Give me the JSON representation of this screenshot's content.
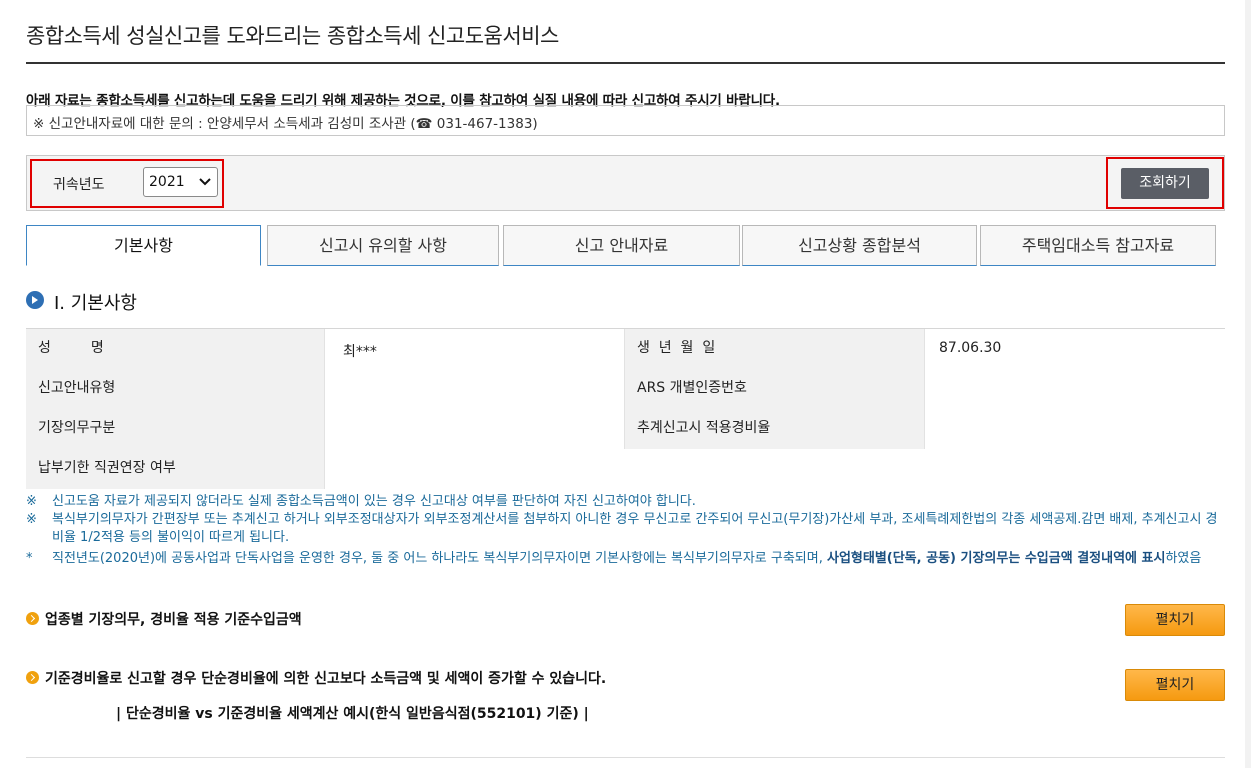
{
  "header": {
    "title": "종합소득세 성실신고를 도와드리는 종합소득세 신고도움서비스"
  },
  "notice": {
    "main": "아래 자료는 종합소득세를 신고하는데 도움을 드리기 위해 제공하는 것으로, 이를 참고하여 실질 내용에 따라 신고하여 주시기 바랍니다.",
    "contact": "※ 신고안내자료에 대한 문의 : 안양세무서 소득세과 김성미 조사관 (☎ 031-467-1383)"
  },
  "filter": {
    "year_label": "귀속년도",
    "year_value": "2021",
    "search_label": "조회하기"
  },
  "tabs": [
    {
      "label": "기본사항",
      "active": true
    },
    {
      "label": "신고시 유의할 사항",
      "active": false
    },
    {
      "label": "신고 안내자료",
      "active": false
    },
    {
      "label": "신고상황 종합분석",
      "active": false
    },
    {
      "label": "주택임대소득 참고자료",
      "active": false
    }
  ],
  "section": {
    "title": "Ⅰ. 기본사항"
  },
  "basic_info": {
    "name_label": "성         명",
    "name_value": "최***",
    "birth_label": "생  년  월  일",
    "birth_value": "87.06.30",
    "guide_type_label": "신고안내유형",
    "guide_type_value": "",
    "ars_label": "ARS 개별인증번호",
    "ars_value": "",
    "bookkeeping_label": "기장의무구분",
    "bookkeeping_value": "",
    "estimated_rate_label": "추계신고시 적용경비율",
    "estimated_rate_value": "",
    "deadline_label": "납부기한 직권연장 여부",
    "deadline_value": ""
  },
  "notes": [
    {
      "mark": "※",
      "text": "신고도움 자료가 제공되지 않더라도 실제 종합소득금액이 있는 경우 신고대상 여부를 판단하여 자진 신고하여야 합니다."
    },
    {
      "mark": "※",
      "text": "복식부기의무자가 간편장부 또는 추계신고 하거나 외부조정대상자가 외부조정계산서를 첨부하지 아니한 경우 무신고로 간주되어 무신고(무기장)가산세 부과, 조세특례제한법의 각종 세액공제.감면 배제, 추계신고시 경비율 1/2적용 등의 불이익이 따르게 됩니다."
    },
    {
      "mark": "*",
      "text": "직전년도(2020년)에 공동사업과 단독사업을 운영한 경우, 둘 중 어느 하나라도 복식부기의무자이면 기본사항에는 복식부기의무자로 구축되며, ",
      "strong": "사업형태별(단독, 공동) 기장의무는 수입금액 결정내역에 표시",
      "tail": "하였음"
    }
  ],
  "sub_sections": [
    {
      "title": "업종별 기장의무, 경비율 적용 기준수입금액",
      "button": "펼치기"
    },
    {
      "title": "기준경비율로 신고할 경우 단순경비율에 의한 신고보다 소득금액 및 세액이 증가할 수 있습니다.",
      "button": "펼치기"
    }
  ],
  "example_caption": "| 단순경비율 vs 기준경비율 세액계산 예시(한식 일반음식점(552101) 기준) |",
  "colors": {
    "accent_blue": "#3e86c4",
    "highlight_red": "#e00000",
    "orange_button": "#f59a10",
    "note_text": "#1a6a9a"
  }
}
